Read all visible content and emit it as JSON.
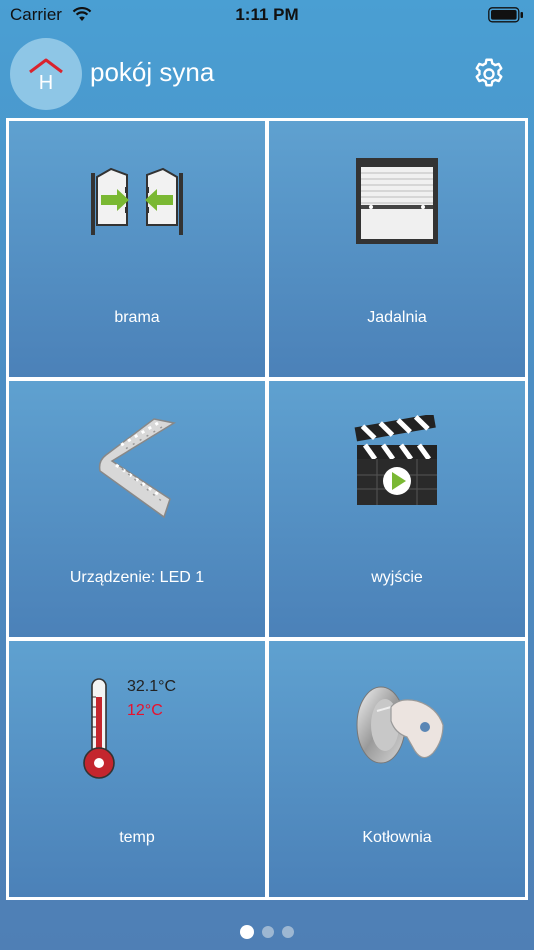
{
  "status_bar": {
    "carrier": "Carrier",
    "time": "1:11 PM"
  },
  "header": {
    "title": "pokój syna",
    "logo_letter": "H"
  },
  "tiles": [
    {
      "label": "brama",
      "icon": "gate-icon"
    },
    {
      "label": "Jadalnia",
      "icon": "roller-shutter-icon"
    },
    {
      "label": "Urządzenie: LED 1",
      "icon": "led-strip-icon"
    },
    {
      "label": "wyjście",
      "icon": "clapperboard-icon"
    },
    {
      "label": "temp",
      "icon": "thermometer-icon",
      "current_temp": "32.1°C",
      "set_temp": "12°C"
    },
    {
      "label": "Kotłownia",
      "icon": "key-icon"
    }
  ],
  "pager": {
    "pages": 3,
    "active": 1
  },
  "colors": {
    "accent_green": "#7ab833",
    "alert_red": "#e8112d",
    "logo_red": "#d9232e"
  }
}
